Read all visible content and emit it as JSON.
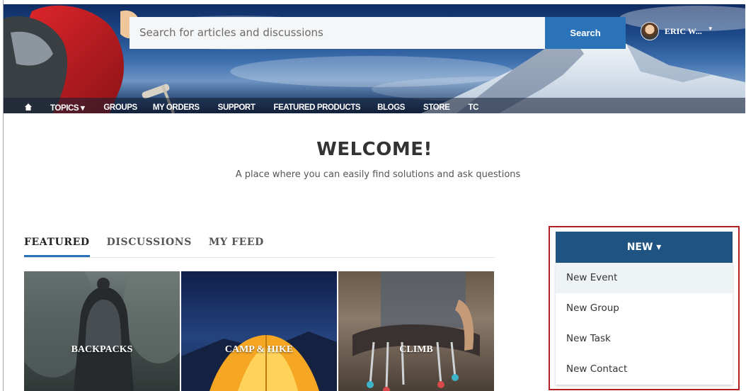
{
  "header": {
    "search_placeholder": "Search for articles and discussions",
    "search_button": "Search",
    "user_name": "ERIC W...",
    "caret": "▼"
  },
  "nav": {
    "items": [
      "TOPICS ▾",
      "GROUPS",
      "MY ORDERS",
      "SUPPORT",
      "FEATURED PRODUCTS",
      "BLOGS",
      "STORE",
      "TC"
    ]
  },
  "welcome": {
    "title": "WELCOME!",
    "tagline": "A place where you can easily find solutions and ask questions"
  },
  "tabs": [
    "FEATURED",
    "DISCUSSIONS",
    "MY FEED"
  ],
  "tiles": [
    "BACKPACKS",
    "CAMP & HIKE",
    "CLIMB"
  ],
  "new_menu": {
    "button_label": "NEW ▾",
    "items": [
      "New Event",
      "New Group",
      "New Task",
      "New Contact"
    ]
  },
  "colors": {
    "primary_button": "#2a73b8",
    "new_button": "#1f5482",
    "highlight_border": "#b01f24"
  }
}
